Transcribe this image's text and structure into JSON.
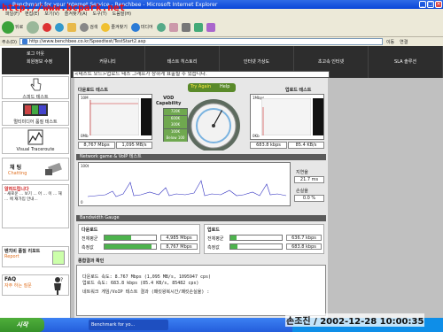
{
  "window": {
    "title": "Benchmark for your Internet Service - Benchbee - Microsoft Internet Explorer",
    "min": "_",
    "max": "□",
    "close": "×"
  },
  "menubar": {
    "items": [
      "파일(F)",
      "편집(E)",
      "보기(V)",
      "즐겨찾기(A)",
      "도구(T)",
      "도움말(H)"
    ]
  },
  "toolbar": {
    "back": "뒤로",
    "search": "검색",
    "favorites": "즐겨찾기",
    "media": "미디어"
  },
  "addressbar": {
    "label": "주소(D)",
    "url": "http://www.benchbee.co.kr/Speedtest/TestStart2.asp",
    "go": "이동",
    "links": "연결"
  },
  "sidebar": {
    "login": "로그 아웃",
    "join": "회원정보 수정",
    "speed_test": "스피드 테스트",
    "multimedia_test": "멀티미디어 품질 테스트",
    "visual_traceroute": "Visual Traceroute",
    "chat_title": "채 팅",
    "chat_sub": "Chatting",
    "announce_title": "알려드립니다",
    "announce_body": "- 새로운 ... 보기 ... 어 ... 이 ... 해 ... 에 재가입 안내...",
    "report_title": "벤치비 품질 리포트",
    "report_sub": "Report",
    "faq_title": "FAQ",
    "faq_sub": "자주 하는 질문"
  },
  "topnav": {
    "tabs": [
      "커뮤니티",
      "테스트 히스토리",
      "인터넷 가상도",
      "초고속 인터넷",
      "SLA 솔루션"
    ]
  },
  "notice": "<테스트 모드>업로드 테스 그래프가 상하게 표출될 수 있습니다.",
  "speedtest": {
    "download_title": "다운로드 테스트",
    "upload_title": "업로드 테스트",
    "vod_title": "VOD",
    "vod_sub": "Capability",
    "vod_levels": [
      "720K",
      "600K",
      "300K",
      "100K",
      "Below 100"
    ],
    "try_again": "Try Again",
    "help": "Help",
    "download_mbps": "8,767 Mbps",
    "download_kbs": "1,095 MB/s",
    "upload_kbps": "683.8 kbps",
    "upload_kbs": "85.4 KB/s",
    "dl_axis_top": "10M",
    "dl_axis_bottom": "0Mb",
    "ul_axis_top": "1Mbps",
    "ul_axis_bottom": "0Kb",
    "gauge_needle_fraction": 0.62
  },
  "network": {
    "title": "Network game & VoIP 테스트",
    "axis_top": "100t",
    "axis_bottom": "0",
    "latency_label": "지연율",
    "latency_value": "21.7 ms",
    "loss_label": "손실율",
    "loss_value": "0.0 %"
  },
  "bandwidth": {
    "title": "Bandwidth Gauge",
    "download_title": "다운로드",
    "upload_title": "업로드",
    "dl_rows": [
      {
        "label": "전체평균",
        "value": "4,985 Mbps",
        "fraction": 0.52
      },
      {
        "label": "측정값",
        "value": "8,767 Mbps",
        "fraction": 0.91
      }
    ],
    "ul_rows": [
      {
        "label": "전체평균",
        "value": "636.7 kbps",
        "fraction": 0.12
      },
      {
        "label": "측정값",
        "value": "683.8 kbps",
        "fraction": 0.13
      }
    ]
  },
  "summary": {
    "title": "종합결과 확인",
    "lines": [
      "다운로드 속도:       8.767 Mbps (1,095 MB/s, 1095947 cps)",
      "업로드 속도:         683.8 kbps (85.4 KB/s, 85482 cps)",
      "네트워크 게임/VoIP 테스트 결과 (패킷왕복시간/패킷손실율) :"
    ]
  },
  "taskbar": {
    "start": "시작",
    "item": "Benchmark for yo..."
  },
  "watermarks": {
    "top_left": "http://www.bcpark.net",
    "bottom_right": "손조진 / 2002-12-28 10:00:35"
  },
  "colors": {
    "accent_green": "#4db34d",
    "nav_dark": "#2d2d2d",
    "gauge_bg": "#5d6b5f",
    "title_blue": "#0a46d8",
    "watermark_red": "#ee1111",
    "graph_blue": "#3030c0",
    "graph_red": "#cc2222"
  }
}
